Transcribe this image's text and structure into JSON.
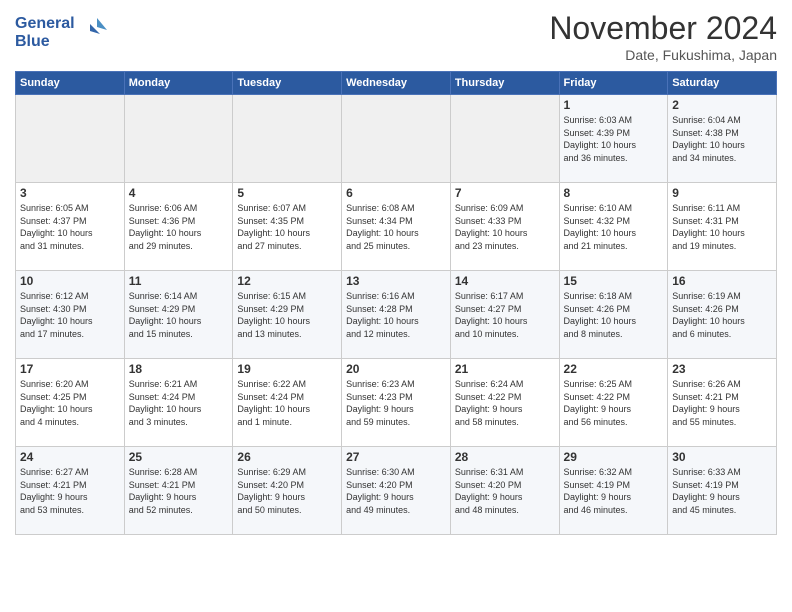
{
  "header": {
    "logo_line1": "General",
    "logo_line2": "Blue",
    "month_title": "November 2024",
    "subtitle": "Date, Fukushima, Japan"
  },
  "weekdays": [
    "Sunday",
    "Monday",
    "Tuesday",
    "Wednesday",
    "Thursday",
    "Friday",
    "Saturday"
  ],
  "weeks": [
    [
      {
        "day": "",
        "info": ""
      },
      {
        "day": "",
        "info": ""
      },
      {
        "day": "",
        "info": ""
      },
      {
        "day": "",
        "info": ""
      },
      {
        "day": "",
        "info": ""
      },
      {
        "day": "1",
        "info": "Sunrise: 6:03 AM\nSunset: 4:39 PM\nDaylight: 10 hours\nand 36 minutes."
      },
      {
        "day": "2",
        "info": "Sunrise: 6:04 AM\nSunset: 4:38 PM\nDaylight: 10 hours\nand 34 minutes."
      }
    ],
    [
      {
        "day": "3",
        "info": "Sunrise: 6:05 AM\nSunset: 4:37 PM\nDaylight: 10 hours\nand 31 minutes."
      },
      {
        "day": "4",
        "info": "Sunrise: 6:06 AM\nSunset: 4:36 PM\nDaylight: 10 hours\nand 29 minutes."
      },
      {
        "day": "5",
        "info": "Sunrise: 6:07 AM\nSunset: 4:35 PM\nDaylight: 10 hours\nand 27 minutes."
      },
      {
        "day": "6",
        "info": "Sunrise: 6:08 AM\nSunset: 4:34 PM\nDaylight: 10 hours\nand 25 minutes."
      },
      {
        "day": "7",
        "info": "Sunrise: 6:09 AM\nSunset: 4:33 PM\nDaylight: 10 hours\nand 23 minutes."
      },
      {
        "day": "8",
        "info": "Sunrise: 6:10 AM\nSunset: 4:32 PM\nDaylight: 10 hours\nand 21 minutes."
      },
      {
        "day": "9",
        "info": "Sunrise: 6:11 AM\nSunset: 4:31 PM\nDaylight: 10 hours\nand 19 minutes."
      }
    ],
    [
      {
        "day": "10",
        "info": "Sunrise: 6:12 AM\nSunset: 4:30 PM\nDaylight: 10 hours\nand 17 minutes."
      },
      {
        "day": "11",
        "info": "Sunrise: 6:14 AM\nSunset: 4:29 PM\nDaylight: 10 hours\nand 15 minutes."
      },
      {
        "day": "12",
        "info": "Sunrise: 6:15 AM\nSunset: 4:29 PM\nDaylight: 10 hours\nand 13 minutes."
      },
      {
        "day": "13",
        "info": "Sunrise: 6:16 AM\nSunset: 4:28 PM\nDaylight: 10 hours\nand 12 minutes."
      },
      {
        "day": "14",
        "info": "Sunrise: 6:17 AM\nSunset: 4:27 PM\nDaylight: 10 hours\nand 10 minutes."
      },
      {
        "day": "15",
        "info": "Sunrise: 6:18 AM\nSunset: 4:26 PM\nDaylight: 10 hours\nand 8 minutes."
      },
      {
        "day": "16",
        "info": "Sunrise: 6:19 AM\nSunset: 4:26 PM\nDaylight: 10 hours\nand 6 minutes."
      }
    ],
    [
      {
        "day": "17",
        "info": "Sunrise: 6:20 AM\nSunset: 4:25 PM\nDaylight: 10 hours\nand 4 minutes."
      },
      {
        "day": "18",
        "info": "Sunrise: 6:21 AM\nSunset: 4:24 PM\nDaylight: 10 hours\nand 3 minutes."
      },
      {
        "day": "19",
        "info": "Sunrise: 6:22 AM\nSunset: 4:24 PM\nDaylight: 10 hours\nand 1 minute."
      },
      {
        "day": "20",
        "info": "Sunrise: 6:23 AM\nSunset: 4:23 PM\nDaylight: 9 hours\nand 59 minutes."
      },
      {
        "day": "21",
        "info": "Sunrise: 6:24 AM\nSunset: 4:22 PM\nDaylight: 9 hours\nand 58 minutes."
      },
      {
        "day": "22",
        "info": "Sunrise: 6:25 AM\nSunset: 4:22 PM\nDaylight: 9 hours\nand 56 minutes."
      },
      {
        "day": "23",
        "info": "Sunrise: 6:26 AM\nSunset: 4:21 PM\nDaylight: 9 hours\nand 55 minutes."
      }
    ],
    [
      {
        "day": "24",
        "info": "Sunrise: 6:27 AM\nSunset: 4:21 PM\nDaylight: 9 hours\nand 53 minutes."
      },
      {
        "day": "25",
        "info": "Sunrise: 6:28 AM\nSunset: 4:21 PM\nDaylight: 9 hours\nand 52 minutes."
      },
      {
        "day": "26",
        "info": "Sunrise: 6:29 AM\nSunset: 4:20 PM\nDaylight: 9 hours\nand 50 minutes."
      },
      {
        "day": "27",
        "info": "Sunrise: 6:30 AM\nSunset: 4:20 PM\nDaylight: 9 hours\nand 49 minutes."
      },
      {
        "day": "28",
        "info": "Sunrise: 6:31 AM\nSunset: 4:20 PM\nDaylight: 9 hours\nand 48 minutes."
      },
      {
        "day": "29",
        "info": "Sunrise: 6:32 AM\nSunset: 4:19 PM\nDaylight: 9 hours\nand 46 minutes."
      },
      {
        "day": "30",
        "info": "Sunrise: 6:33 AM\nSunset: 4:19 PM\nDaylight: 9 hours\nand 45 minutes."
      }
    ]
  ]
}
